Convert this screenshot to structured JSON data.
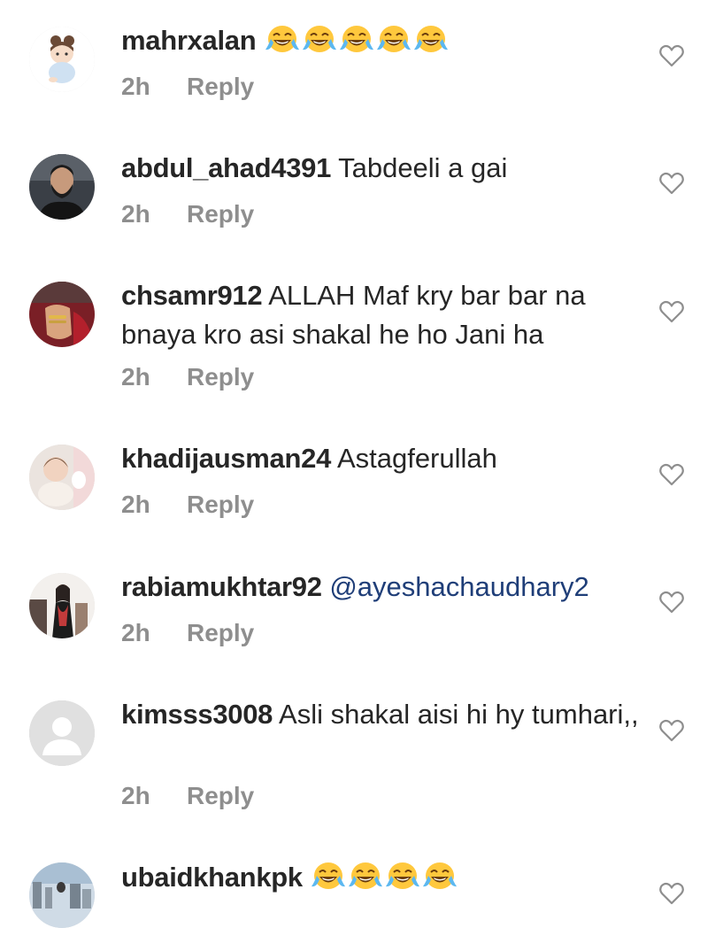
{
  "comments": [
    {
      "username": "mahrxalan",
      "text": "",
      "emoji": [
        "face-with-tears-of-joy",
        "face-with-tears-of-joy",
        "face-with-tears-of-joy",
        "face-with-tears-of-joy",
        "face-with-tears-of-joy"
      ],
      "time": "2h",
      "reply_label": "Reply",
      "avatar_icon": "cartoon-baby-avatar"
    },
    {
      "username": "abdul_ahad4391",
      "text": "Tabdeeli a gai",
      "time": "2h",
      "reply_label": "Reply",
      "avatar_icon": "man-photo-avatar"
    },
    {
      "username": "chsamr912",
      "text": "ALLAH Maf kry bar bar na bnaya kro asi shakal he ho Jani ha",
      "time": "2h",
      "reply_label": "Reply",
      "avatar_icon": "hand-photo-avatar"
    },
    {
      "username": "khadijausman24",
      "text": "Astagferullah",
      "time": "2h",
      "reply_label": "Reply",
      "avatar_icon": "baby-photo-avatar"
    },
    {
      "username": "rabiamukhtar92",
      "text": "",
      "mention": "@ayeshachaudhary2",
      "time": "2h",
      "reply_label": "Reply",
      "avatar_icon": "woman-photo-avatar"
    },
    {
      "username": "kimsss3008",
      "text": "Asli shakal aisi hi hy tumhari,,",
      "time": "2h",
      "reply_label": "Reply",
      "avatar_icon": "default-user-avatar"
    },
    {
      "username": "ubaidkhankpk",
      "text": "",
      "emoji": [
        "face-with-tears-of-joy",
        "face-with-tears-of-joy",
        "face-with-tears-of-joy",
        "face-with-tears-of-joy"
      ],
      "avatar_icon": "street-photo-avatar"
    }
  ],
  "like_icon": "heart-outline-icon",
  "colors": {
    "text": "#262626",
    "meta": "#8e8e8e",
    "mention": "#1f3e78",
    "emoji_face": "#ffc83d"
  }
}
